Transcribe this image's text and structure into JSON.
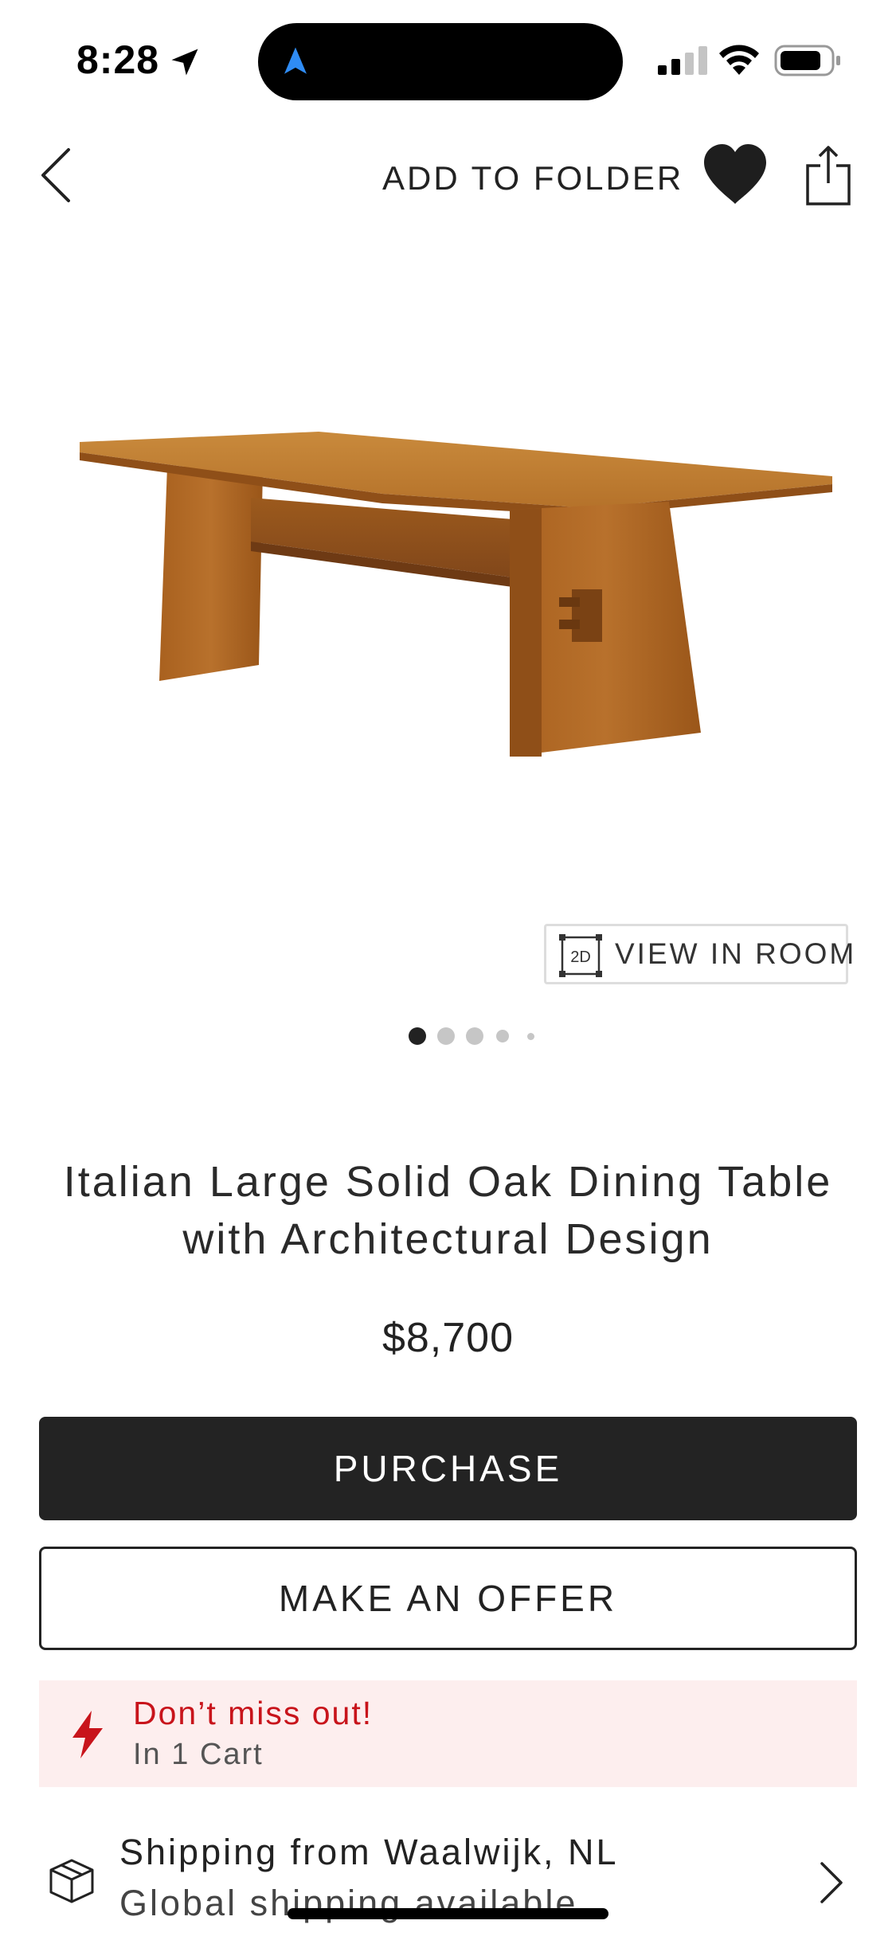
{
  "status_bar": {
    "time": "8:28",
    "icons": [
      "location-arrow-icon",
      "navigation-icon",
      "cellular-signal-icon",
      "wifi-icon",
      "battery-icon"
    ]
  },
  "nav": {
    "back_icon": "chevron-left-icon",
    "add_to_folder_label": "ADD TO FOLDER",
    "favorite_icon": "heart-icon",
    "share_icon": "share-icon"
  },
  "product": {
    "image_alt": "wooden-dining-table",
    "view_in_room_badge": "2D",
    "view_in_room_label": "VIEW IN ROOM",
    "image_pagination": {
      "total": 5,
      "current": 1
    },
    "title": "Italian Large Solid Oak Dining Table with Architectural Design",
    "price": "$8,700"
  },
  "actions": {
    "purchase_label": "PURCHASE",
    "offer_label": "MAKE AN OFFER"
  },
  "alert": {
    "icon": "lightning-icon",
    "title": "Don’t miss out!",
    "subtitle": "In 1 Cart",
    "accent_color": "#c8141b"
  },
  "shipping": {
    "icon": "package-icon",
    "title": "Shipping from Waalwijk, NL",
    "subtitle": "Global shipping available"
  },
  "colors": {
    "button_dark": "#232323",
    "alert_bg": "#fdeeee",
    "nav_blue": "#2f8cf5"
  }
}
